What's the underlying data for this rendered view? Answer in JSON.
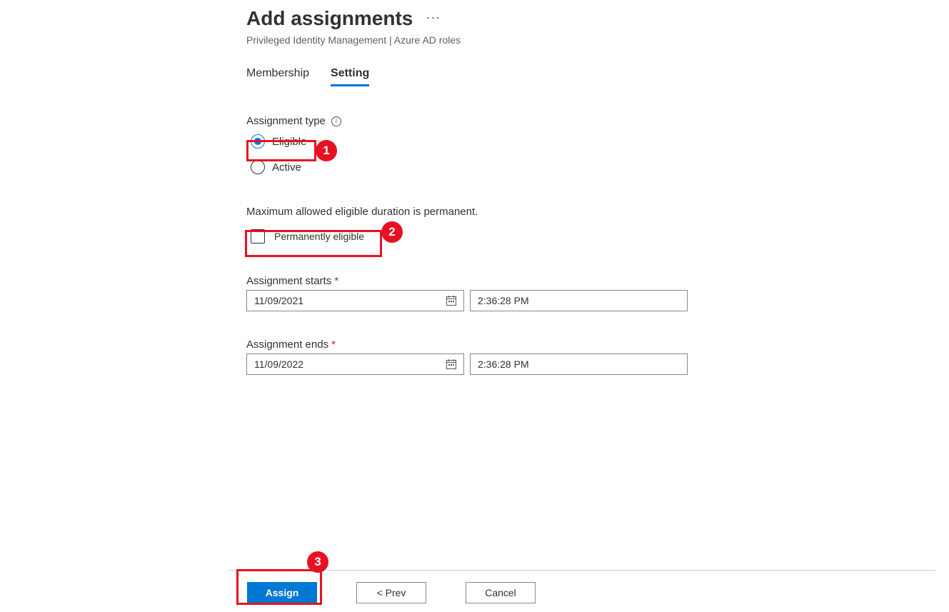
{
  "header": {
    "title": "Add assignments",
    "subtitle": "Privileged Identity Management | Azure AD roles"
  },
  "tabs": {
    "membership": "Membership",
    "setting": "Setting"
  },
  "form": {
    "assignment_type_label": "Assignment type",
    "eligible_label": "Eligible",
    "active_label": "Active",
    "duration_note": "Maximum allowed eligible duration is permanent.",
    "permanently_eligible_label": "Permanently eligible",
    "assignment_starts_label": "Assignment starts",
    "assignment_ends_label": "Assignment ends",
    "start_date": "11/09/2021",
    "start_time": "2:36:28 PM",
    "end_date": "11/09/2022",
    "end_time": "2:36:28 PM"
  },
  "footer": {
    "assign": "Assign",
    "prev": "<  Prev",
    "cancel": "Cancel"
  },
  "callouts": {
    "one": "1",
    "two": "2",
    "three": "3"
  }
}
